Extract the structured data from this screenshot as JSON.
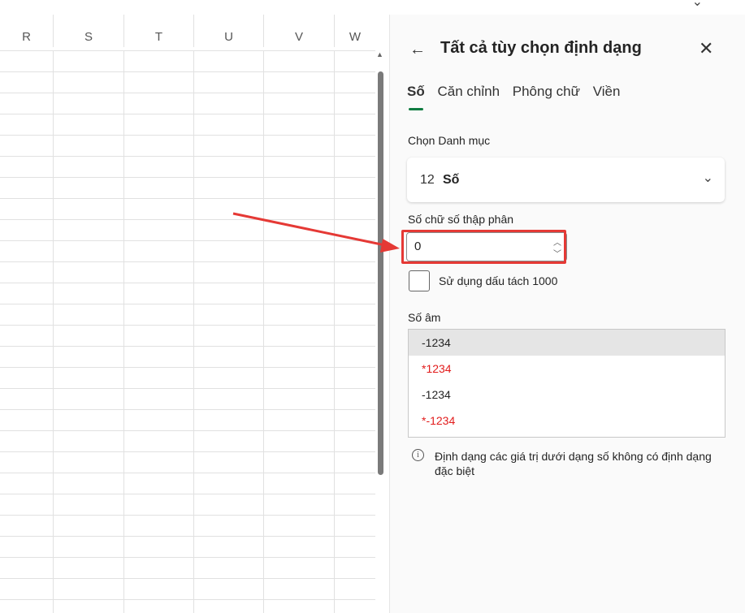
{
  "spreadsheet": {
    "columns": [
      "R",
      "S",
      "T",
      "U",
      "V",
      "W"
    ]
  },
  "pane": {
    "title": "Tất cả tùy chọn định dạng",
    "back_icon": "←",
    "close_icon": "✕",
    "tabs": [
      {
        "label": "Số",
        "active": true
      },
      {
        "label": "Căn chỉnh",
        "active": false
      },
      {
        "label": "Phông chữ",
        "active": false
      },
      {
        "label": "Viền",
        "active": false
      }
    ],
    "category_label": "Chọn Danh mục",
    "category_icon": "12",
    "category_value": "Số",
    "decimal_label": "Số chữ số thập phân",
    "decimal_value": "0",
    "separator_label": "Sử dụng dấu tách 1000",
    "separator_checked": false,
    "negative_label": "Số âm",
    "negative_options": [
      {
        "text": "-1234",
        "color": "#242424",
        "selected": true
      },
      {
        "text": "*1234",
        "color": "#e21c1c",
        "selected": false
      },
      {
        "text": "-1234",
        "color": "#242424",
        "selected": false
      },
      {
        "text": "*-1234",
        "color": "#e21c1c",
        "selected": false
      }
    ],
    "info_icon": "i",
    "info_text": "Định dạng các giá trị dưới dạng số không có định dạng đặc biệt"
  },
  "colors": {
    "accent": "#107c41",
    "highlight": "#e53935",
    "negative_red": "#e21c1c"
  }
}
